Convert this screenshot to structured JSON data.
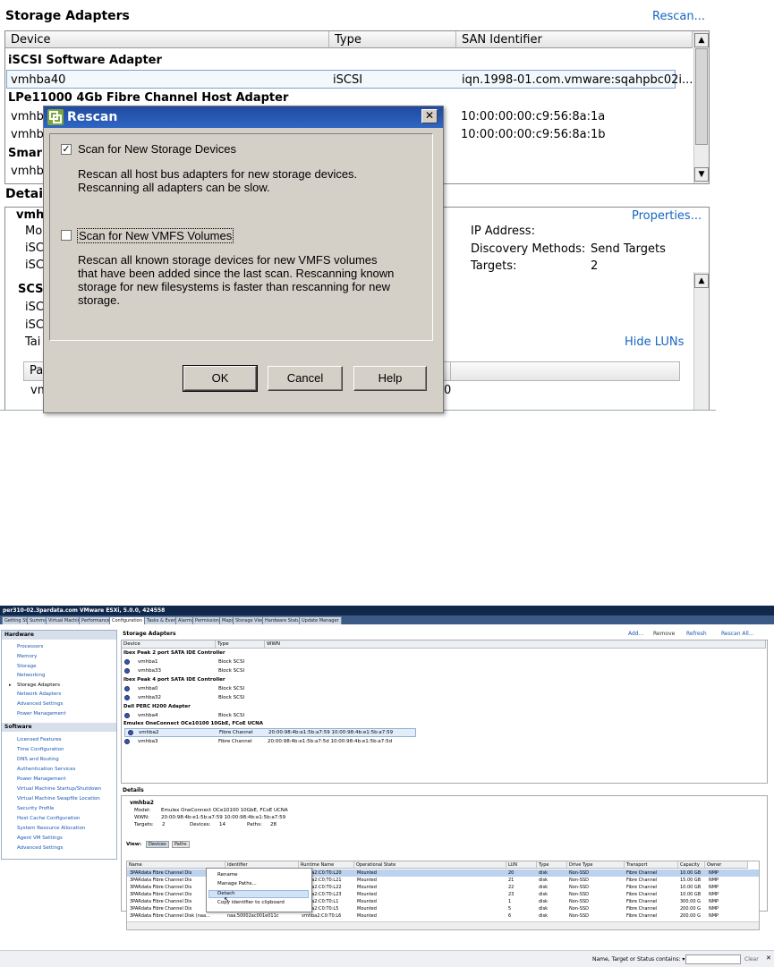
{
  "top": {
    "storage_adapters_title": "Storage Adapters",
    "rescan_link": "Rescan...",
    "columns": [
      "Device",
      "Type",
      "SAN Identifier"
    ],
    "group1": "iSCSI Software Adapter",
    "row1": {
      "device": "vmhba40",
      "type": "iSCSI",
      "san": "iqn.1998-01.com.vmware:sqahpbc02i..."
    },
    "group2": "LPe11000 4Gb Fibre Channel Host Adapter",
    "row2": {
      "device": "vmhb",
      "san": "10:00:00:00:c9:56:8a:1a"
    },
    "row3": {
      "device": "vmhb",
      "san": "10:00:00:00:c9:56:8a:1b"
    },
    "group3": "Smar",
    "row4": {
      "device": "vmhb"
    },
    "details_title": "Detail",
    "details": {
      "name": "vmh",
      "l1": "Mo",
      "l2": "iSC",
      "l3": "iSC",
      "properties_link": "Properties...",
      "ip_label": "IP Address:",
      "discovery_label": "Discovery Methods:",
      "discovery_value": "Send Targets",
      "targets_label": "Targets:",
      "targets_value": "2",
      "scsi_label": "SCS",
      "s1": "iSC",
      "s2": "iSC",
      "s3": "Tai",
      "hide_luns": "Hide LUNs",
      "pa_col": "Pa",
      "vm_row": "vm",
      "trail": "0"
    }
  },
  "dialog": {
    "title": "Rescan",
    "close": "✕",
    "opt1_label": "Scan for New Storage Devices",
    "opt1_checked": true,
    "opt1_desc_line1": "Rescan all host bus adapters for new storage devices.",
    "opt1_desc_line2": "Rescanning all adapters can be slow.",
    "opt2_label": "Scan for New VMFS Volumes",
    "opt2_checked": false,
    "opt2_desc_line1": "Rescan all known storage devices for new VMFS volumes",
    "opt2_desc_line2": "that have been added since the last scan. Rescanning known",
    "opt2_desc_line3": "storage for new filesystems is faster than rescanning for new",
    "opt2_desc_line4": "storage.",
    "ok": "OK",
    "cancel": "Cancel",
    "help": "Help"
  },
  "vsphere": {
    "window_title": "per310-02.3pardata.com VMware ESXi, 5.0.0, 424558",
    "tabs": [
      "Getting Started",
      "Summary",
      "Virtual Machines",
      "Performance",
      "Configuration",
      "Tasks & Events",
      "Alarms",
      "Permissions",
      "Maps",
      "Storage Views",
      "Hardware Status",
      "Update Manager"
    ],
    "active_tab": "Configuration",
    "hardware_header": "Hardware",
    "hardware_items": [
      "Processors",
      "Memory",
      "Storage",
      "Networking",
      "Storage Adapters",
      "Network Adapters",
      "Advanced Settings",
      "Power Management"
    ],
    "software_header": "Software",
    "software_items": [
      "Licensed Features",
      "Time Configuration",
      "DNS and Routing",
      "Authentication Services",
      "Power Management",
      "Virtual Machine Startup/Shutdown",
      "Virtual Machine Swapfile Location",
      "Security Profile",
      "Host Cache Configuration",
      "System Resource Allocation",
      "Agent VM Settings",
      "Advanced Settings"
    ],
    "storage_adapters": "Storage Adapters",
    "actions": {
      "add": "Add...",
      "remove": "Remove",
      "refresh": "Refresh",
      "rescan_all": "Rescan All..."
    },
    "cols": [
      "Device",
      "Type",
      "WWN"
    ],
    "g1": "Ibex Peak 2 port SATA IDE Controller",
    "r1": {
      "d": "vmhba1",
      "t": "Block SCSI"
    },
    "r2": {
      "d": "vmhba33",
      "t": "Block SCSI"
    },
    "g2": "Ibex Peak 4 port SATA IDE Controller",
    "r3": {
      "d": "vmhba0",
      "t": "Block SCSI"
    },
    "r4": {
      "d": "vmhba32",
      "t": "Block SCSI"
    },
    "g3": "Dell PERC H200 Adapter",
    "r5": {
      "d": "vmhba4",
      "t": "Block SCSI"
    },
    "g4": "Emulex OneConnect OCe10100 10GbE, FCoE UCNA",
    "r6": {
      "d": "vmhba2",
      "t": "Fibre Channel",
      "w": "20:00:98:4b:e1:5b:a7:59 10:00:98:4b:e1:5b:a7:59"
    },
    "r7": {
      "d": "vmhba3",
      "t": "Fibre Channel",
      "w": "20:00:98:4b:e1:5b:a7:5d 10:00:98:4b:e1:5b:a7:5d"
    },
    "details_title": "Details",
    "det_name": "vmhba2",
    "det_model_label": "Model:",
    "det_model": "Emulex OneConnect OCe10100 10GbE, FCoE UCNA",
    "det_wwn_label": "WWN:",
    "det_wwn": "20:00:98:4b:e1:5b:a7:59 10:00:98:4b:e1:5b:a7:59",
    "det_targets_label": "Targets:",
    "det_targets": "2",
    "det_devices_label": "Devices:",
    "det_devices": "14",
    "det_paths_label": "Paths:",
    "det_paths": "28",
    "view_label": "View:",
    "view_devices": "Devices",
    "view_paths": "Paths",
    "dev_cols": [
      "Name",
      "Identifier",
      "Runtime Name",
      "Operational State",
      "LUN",
      "Type",
      "Drive Type",
      "Transport",
      "Capacity",
      "Owner"
    ],
    "dev_rows": [
      {
        "name": "3PARdata Fibre Channel Dis",
        "id": "",
        "rt": "mhba2:C0:T0:L20",
        "state": "Mounted",
        "lun": "20",
        "type": "disk",
        "drive": "Non-SSD",
        "tr": "Fibre Channel",
        "cap": "10.00 GB",
        "own": "NMP"
      },
      {
        "name": "3PARdata Fibre Channel Dis",
        "id": "",
        "rt": "mhba2:C0:T0:L21",
        "state": "Mounted",
        "lun": "21",
        "type": "disk",
        "drive": "Non-SSD",
        "tr": "Fibre Channel",
        "cap": "15.00 GB",
        "own": "NMP"
      },
      {
        "name": "3PARdata Fibre Channel Dis",
        "id": "",
        "rt": "mhba2:C0:T0:L22",
        "state": "Mounted",
        "lun": "22",
        "type": "disk",
        "drive": "Non-SSD",
        "tr": "Fibre Channel",
        "cap": "10.00 GB",
        "own": "NMP"
      },
      {
        "name": "3PARdata Fibre Channel Dis",
        "id": "",
        "rt": "mhba2:C0:T0:L23",
        "state": "Mounted",
        "lun": "23",
        "type": "disk",
        "drive": "Non-SSD",
        "tr": "Fibre Channel",
        "cap": "10.00 GB",
        "own": "NMP"
      },
      {
        "name": "3PARdata Fibre Channel Dis",
        "id": "",
        "rt": "mhba2:C0:T0:L1",
        "state": "Mounted",
        "lun": "1",
        "type": "disk",
        "drive": "Non-SSD",
        "tr": "Fibre Channel",
        "cap": "300.00 G",
        "own": "NMP"
      },
      {
        "name": "3PARdata Fibre Channel Dis",
        "id": "",
        "rt": "mhba2:C0:T0:L5",
        "state": "Mounted",
        "lun": "5",
        "type": "disk",
        "drive": "Non-SSD",
        "tr": "Fibre Channel",
        "cap": "200.00 G",
        "own": "NMP"
      },
      {
        "name": "3PARdata Fibre Channel Disk (naa...",
        "id": "naa.50002ac001e011c",
        "rt": "vmhba2:C0:T0:L6",
        "state": "Mounted",
        "lun": "6",
        "type": "disk",
        "drive": "Non-SSD",
        "tr": "Fibre Channel",
        "cap": "200.00 G",
        "own": "NMP"
      }
    ],
    "context_menu": [
      "Rename",
      "Manage Paths...",
      "Detach",
      "Copy identifier to clipboard"
    ],
    "status_filter_label": "Name, Target or Status contains: ▾",
    "clear": "Clear"
  }
}
